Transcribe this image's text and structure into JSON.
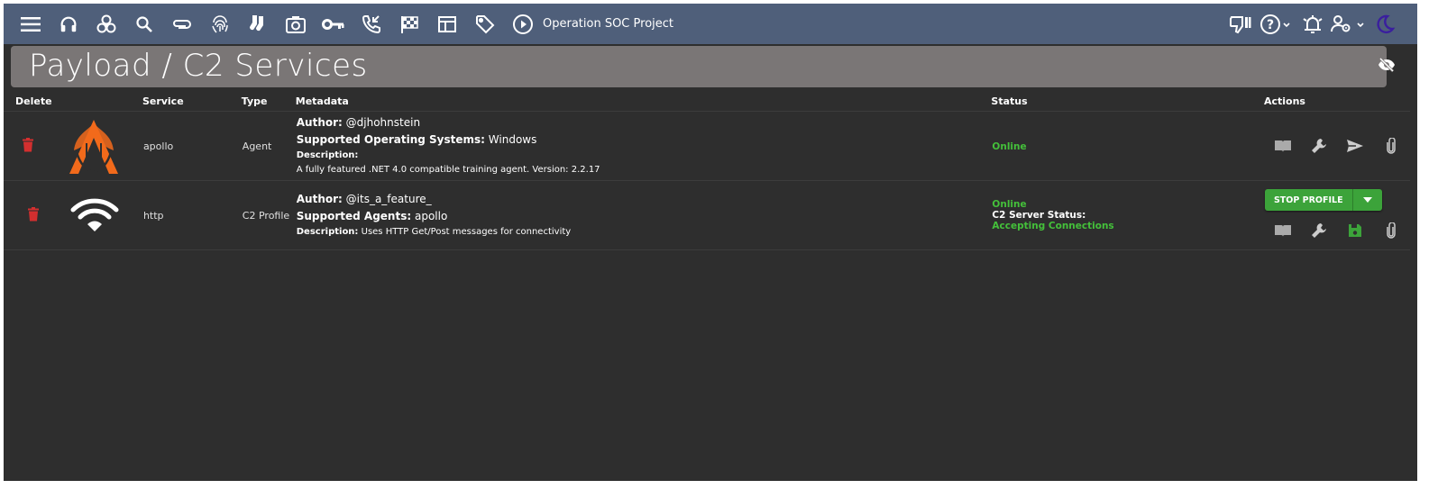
{
  "appbar": {
    "operation_name": "Operation SOC Project",
    "left_icons": [
      "menu-icon",
      "headphones-icon",
      "biohazard-icon",
      "search-icon",
      "paperclip-icon",
      "fingerprint-icon",
      "socks-icon",
      "camera-icon",
      "key-icon",
      "phone-callback-icon",
      "checkered-flag-icon",
      "table-icon",
      "tag-icon",
      "play-circle-icon"
    ],
    "right_icons": [
      "thumbs-down-icon",
      "help-icon",
      "alert-bell-icon",
      "user-settings-icon",
      "dark-mode-moon-icon"
    ]
  },
  "page": {
    "title": "Payload / C2 Services"
  },
  "table": {
    "headers": {
      "delete": "Delete",
      "service": "Service",
      "type": "Type",
      "metadata": "Metadata",
      "status": "Status",
      "actions": "Actions"
    },
    "rows": [
      {
        "service": "apollo",
        "type": "Agent",
        "author_label": "Author:",
        "author": "@djhohnstein",
        "second_label": "Supported Operating Systems:",
        "second_value": "Windows",
        "description_label": "Description:",
        "description": "A fully featured .NET 4.0 compatible training agent. Version: 2.2.17",
        "status": "Online"
      },
      {
        "service": "http",
        "type": "C2 Profile",
        "author_label": "Author:",
        "author": "@its_a_feature_",
        "second_label": "Supported Agents:",
        "second_value": "apollo",
        "description_label": "Description:",
        "description": "Uses HTTP Get/Post messages for connectivity",
        "status": "Online",
        "server_status_label": "C2 Server Status:",
        "server_status": "Accepting Connections",
        "stop_button_label": "STOP PROFILE"
      }
    ]
  },
  "colors": {
    "appbar": "#4f5f7a",
    "background": "#2e2e2e",
    "header_bar": "#7a7676",
    "online_green": "#44c03a",
    "delete_red": "#d32f2f",
    "apollo_orange": "#f26a1b"
  }
}
